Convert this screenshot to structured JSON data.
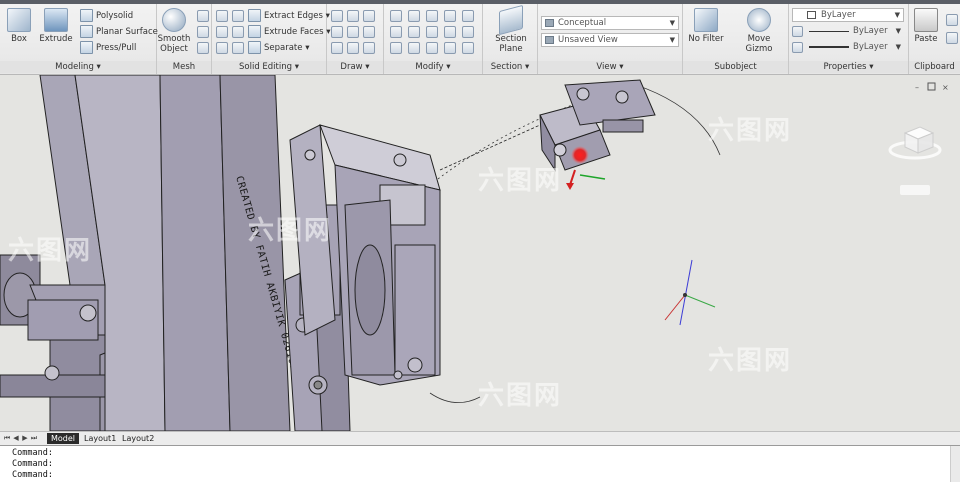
{
  "ribbon": {
    "modeling": {
      "title": "Modeling",
      "box": "Box",
      "extrude": "Extrude",
      "polysolid": "Polysolid",
      "planar_surface": "Planar Surface",
      "press_pull": "Press/Pull"
    },
    "mesh": {
      "title": "Mesh",
      "smooth_object": "Smooth\nObject"
    },
    "solid_editing": {
      "title": "Solid Editing",
      "extract_edges": "Extract Edges",
      "extrude_faces": "Extrude Faces",
      "separate": "Separate"
    },
    "draw": {
      "title": "Draw"
    },
    "modify": {
      "title": "Modify"
    },
    "section": {
      "title": "Section",
      "section_plane": "Section\nPlane"
    },
    "view": {
      "title": "View",
      "visual_style": "Conceptual",
      "named_view": "Unsaved View"
    },
    "subobject": {
      "title": "Subobject",
      "no_filter": "No Filter",
      "move_gizmo": "Move Gizmo"
    },
    "properties": {
      "title": "Properties",
      "color": "ByLayer",
      "linetype": "ByLayer",
      "lineweight": "ByLayer"
    },
    "clipboard": {
      "title": "Clipboard",
      "paste": "Paste"
    }
  },
  "viewport": {
    "engraving": "CREATED BY FATIH AKBIYIK 02610909023",
    "watermark": "六图网"
  },
  "layout_tabs": [
    "Model",
    "Layout1",
    "Layout2"
  ],
  "command_history": [
    "Command:",
    "Command:",
    "Command:"
  ]
}
